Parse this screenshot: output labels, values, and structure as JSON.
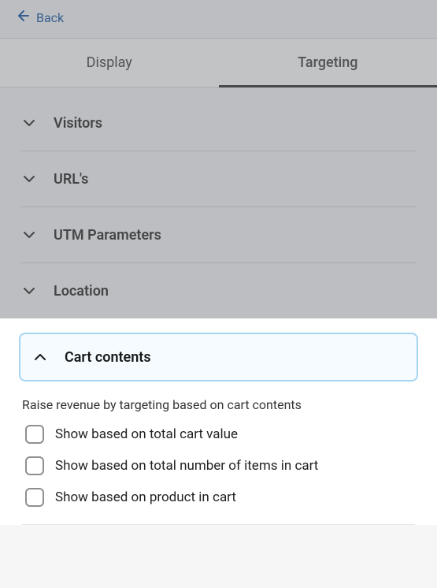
{
  "header": {
    "back_label": "Back"
  },
  "tabs": [
    {
      "label": "Display",
      "active": false
    },
    {
      "label": "Targeting",
      "active": true
    }
  ],
  "sections": {
    "collapsed": [
      {
        "title": "Visitors"
      },
      {
        "title": "URL's"
      },
      {
        "title": "UTM Parameters"
      },
      {
        "title": "Location"
      }
    ],
    "expanded": {
      "title": "Cart contents",
      "description": "Raise revenue by targeting based on cart contents",
      "options": [
        {
          "label": "Show based on total cart value"
        },
        {
          "label": "Show based on total number of items in cart"
        },
        {
          "label": "Show based on product in cart"
        }
      ]
    }
  }
}
